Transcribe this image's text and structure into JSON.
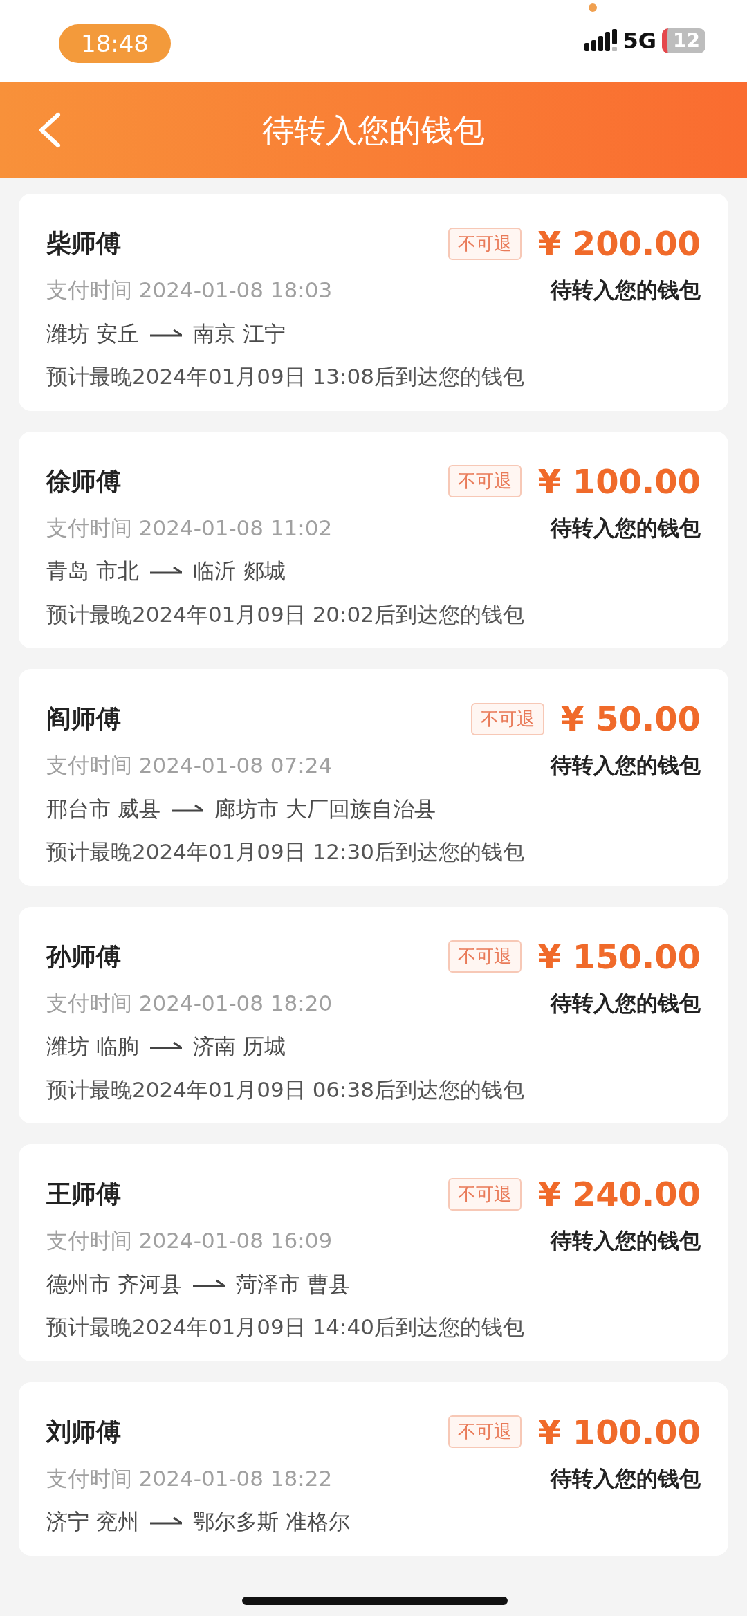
{
  "status_bar": {
    "time": "18:48",
    "network": "5G",
    "battery": "12"
  },
  "header": {
    "title": "待转入您的钱包"
  },
  "orders": [
    {
      "name": "柴师傅",
      "tag": "不可退",
      "amount": "¥ 200.00",
      "status": "待转入您的钱包",
      "pay_time": "支付时间 2024-01-08 18:03",
      "from": "潍坊 安丘",
      "to": "南京 江宁",
      "estimate": "预计最晚2024年01月09日 13:08后到达您的钱包"
    },
    {
      "name": "徐师傅",
      "tag": "不可退",
      "amount": "¥ 100.00",
      "status": "待转入您的钱包",
      "pay_time": "支付时间 2024-01-08 11:02",
      "from": "青岛 市北",
      "to": "临沂 郯城",
      "estimate": "预计最晚2024年01月09日 20:02后到达您的钱包"
    },
    {
      "name": "阎师傅",
      "tag": "不可退",
      "amount": "¥ 50.00",
      "status": "待转入您的钱包",
      "pay_time": "支付时间 2024-01-08 07:24",
      "from": "邢台市 威县",
      "to": "廊坊市 大厂回族自治县",
      "estimate": "预计最晚2024年01月09日 12:30后到达您的钱包"
    },
    {
      "name": "孙师傅",
      "tag": "不可退",
      "amount": "¥ 150.00",
      "status": "待转入您的钱包",
      "pay_time": "支付时间 2024-01-08 18:20",
      "from": "潍坊 临朐",
      "to": "济南 历城",
      "estimate": "预计最晚2024年01月09日 06:38后到达您的钱包"
    },
    {
      "name": "王师傅",
      "tag": "不可退",
      "amount": "¥ 240.00",
      "status": "待转入您的钱包",
      "pay_time": "支付时间 2024-01-08 16:09",
      "from": "德州市 齐河县",
      "to": "菏泽市 曹县",
      "estimate": "预计最晚2024年01月09日 14:40后到达您的钱包"
    },
    {
      "name": "刘师傅",
      "tag": "不可退",
      "amount": "¥ 100.00",
      "status": "待转入您的钱包",
      "pay_time": "支付时间 2024-01-08 18:22",
      "from": "济宁 兖州",
      "to": "鄂尔多斯 准格尔"
    }
  ]
}
